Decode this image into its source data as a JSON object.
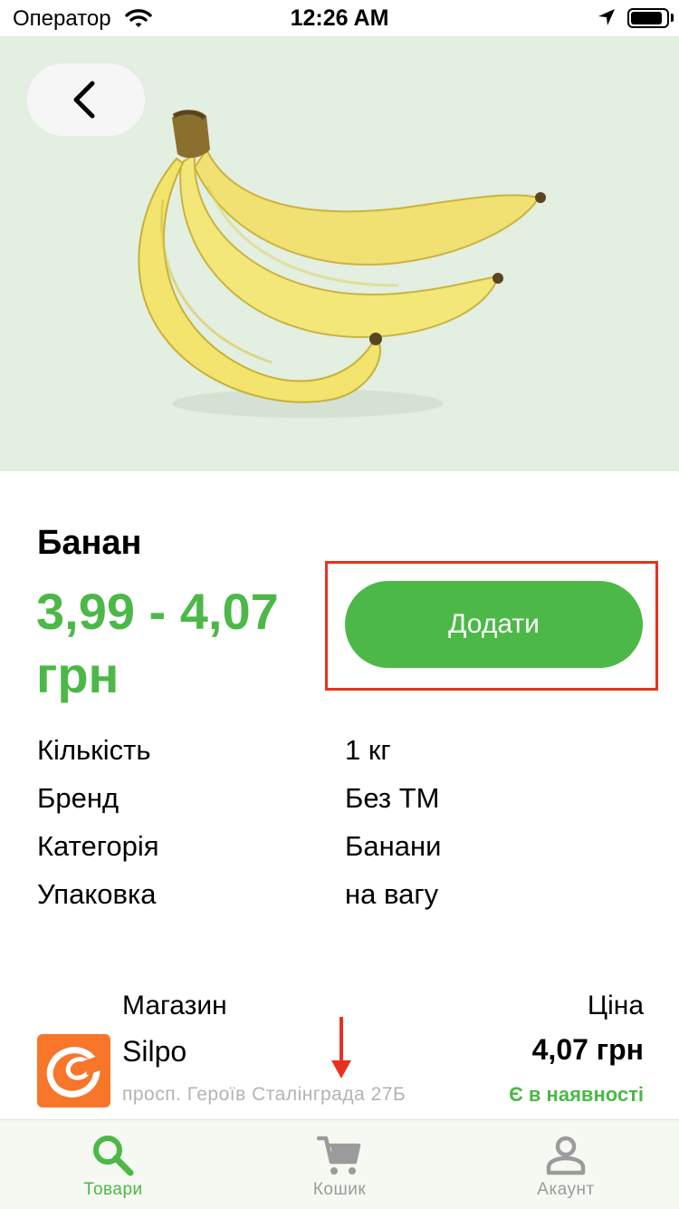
{
  "status_bar": {
    "carrier": "Оператор",
    "time": "12:26 AM",
    "battery_level": 0.9
  },
  "product": {
    "name": "Банан",
    "price": "3,99 - 4,07 грн",
    "add_button_label": "Додати",
    "image": "banana-bunch"
  },
  "specs": [
    {
      "label": "Кількість",
      "value": "1 кг"
    },
    {
      "label": "Бренд",
      "value": "Без ТМ"
    },
    {
      "label": "Категорія",
      "value": "Банани"
    },
    {
      "label": "Упаковка",
      "value": "на вагу"
    }
  ],
  "store": {
    "column_title": "Магазин",
    "name": "Silpo",
    "address": "просп. Героїв Сталінграда 27Б",
    "price_column_title": "Ціна",
    "price": "4,07 грн",
    "availability": "Є в наявності",
    "logo_color": "#f7762a"
  },
  "tabs": [
    {
      "label": "Товари",
      "icon": "search-icon",
      "active": true
    },
    {
      "label": "Кошик",
      "icon": "cart-icon",
      "active": false
    },
    {
      "label": "Акаунт",
      "icon": "person-icon",
      "active": false
    }
  ],
  "colors": {
    "accent": "#4cb847",
    "highlight": "#e8321f",
    "hero_background": "#e3efe1"
  }
}
